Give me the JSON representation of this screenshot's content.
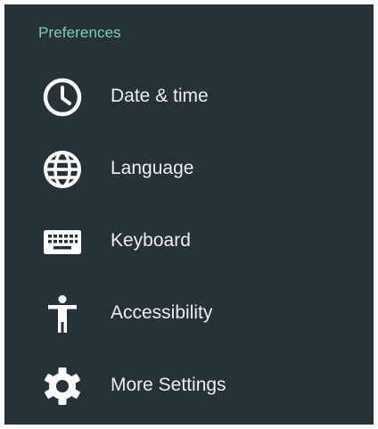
{
  "section": {
    "title": "Preferences"
  },
  "menu": {
    "items": [
      {
        "label": "Date & time",
        "icon": "clock-icon"
      },
      {
        "label": "Language",
        "icon": "globe-icon"
      },
      {
        "label": "Keyboard",
        "icon": "keyboard-icon"
      },
      {
        "label": "Accessibility",
        "icon": "accessibility-icon"
      },
      {
        "label": "More Settings",
        "icon": "gear-icon"
      }
    ]
  },
  "colors": {
    "panel_background": "#263238",
    "section_title": "#7ecbbd",
    "item_text": "#eceff1",
    "icon": "#ffffff"
  }
}
